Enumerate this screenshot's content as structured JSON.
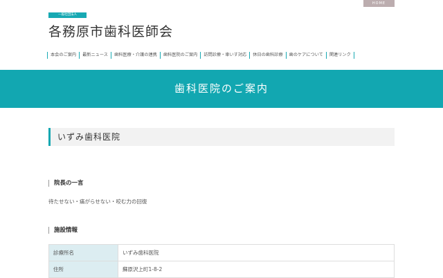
{
  "header": {
    "home_label": "HOME",
    "badge": "一般社団法人",
    "site_title": "各務原市歯科医師会"
  },
  "nav": [
    "本会のご案内",
    "最新ニュース",
    "歯科医療・介護の連携",
    "歯科医院のご案内",
    "訪問診療・車いす対応",
    "休日の歯科診療",
    "歯のケアについて",
    "関連リンク"
  ],
  "banner": {
    "title": "歯科医院のご案内"
  },
  "clinic": {
    "name": "いずみ歯科医院"
  },
  "message": {
    "heading": "院長の一言",
    "text": "待たせない・痛がらせない・咬む力の回復"
  },
  "facility": {
    "heading": "施設情報",
    "rows": [
      {
        "label": "診療所名",
        "value": "いずみ歯科医院"
      },
      {
        "label": "住所",
        "value": "蘇原沢上町1-8-2"
      }
    ]
  }
}
